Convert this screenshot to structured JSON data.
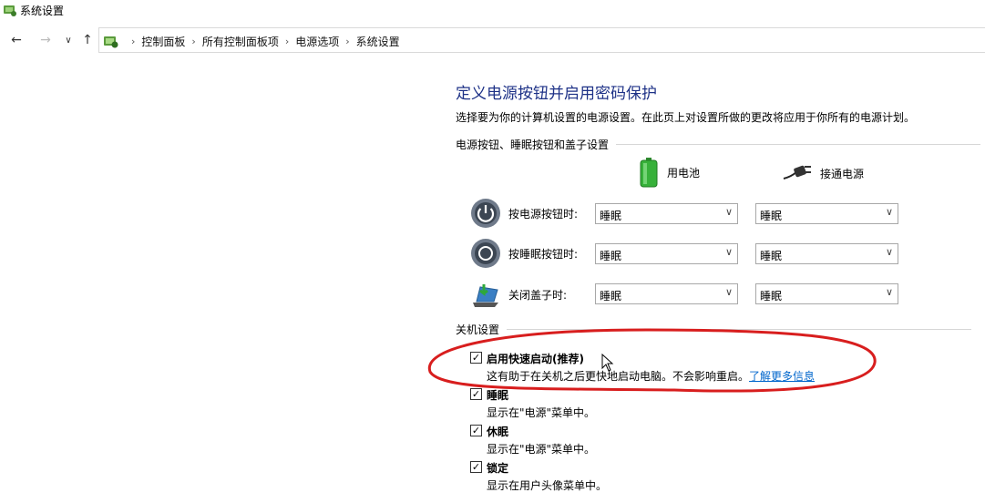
{
  "window": {
    "title": "系统设置"
  },
  "breadcrumb": [
    "控制面板",
    "所有控制面板项",
    "电源选项",
    "系统设置"
  ],
  "page": {
    "title": "定义电源按钮并启用密码保护",
    "description": "选择要为你的计算机设置的电源设置。在此页上对设置所做的更改将应用于你所有的电源计划。"
  },
  "power_buttons": {
    "header": "电源按钮、睡眠按钮和盖子设置",
    "columns": {
      "battery": "用电池",
      "plugged": "接通电源"
    },
    "rows": [
      {
        "label": "按电源按钮时:",
        "battery": "睡眠",
        "plugged": "睡眠",
        "icon": "power-button-icon"
      },
      {
        "label": "按睡眠按钮时:",
        "battery": "睡眠",
        "plugged": "睡眠",
        "icon": "sleep-button-icon"
      },
      {
        "label": "关闭盖子时:",
        "battery": "睡眠",
        "plugged": "睡眠",
        "icon": "laptop-lid-icon"
      }
    ]
  },
  "shutdown": {
    "header": "关机设置",
    "items": [
      {
        "label": "启用快速启动(推荐)",
        "desc": "这有助于在关机之后更快地启动电脑。不会影响重启。",
        "link": "了解更多信息",
        "checked": true
      },
      {
        "label": "睡眠",
        "desc": "显示在\"电源\"菜单中。",
        "checked": true
      },
      {
        "label": "休眠",
        "desc": "显示在\"电源\"菜单中。",
        "checked": true
      },
      {
        "label": "锁定",
        "desc": "显示在用户头像菜单中。",
        "checked": true
      }
    ]
  },
  "annotation": {
    "color": "#d81e1e"
  },
  "colors": {
    "title": "#1e3287",
    "link": "#0066cc"
  }
}
